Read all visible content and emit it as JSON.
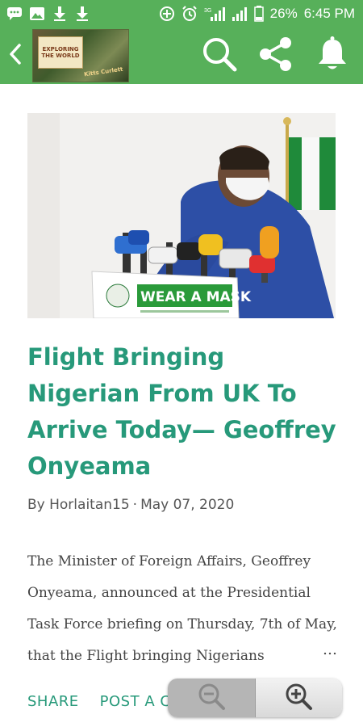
{
  "status_bar": {
    "battery_percent": "26%",
    "time": "6:45 PM",
    "network_label": "3G",
    "left_icons": [
      "chat-icon",
      "image-icon",
      "download-icon",
      "download-icon"
    ],
    "right_icons": [
      "data-saver-icon",
      "alarm-icon",
      "signal-icon",
      "signal-icon",
      "battery-icon"
    ]
  },
  "app_bar": {
    "logo": {
      "line1": "EXPLORING",
      "line2": "THE WORLD",
      "tag": "Kitts Curlett"
    },
    "icons": [
      "back-icon",
      "search-icon",
      "share-icon",
      "bell-icon"
    ]
  },
  "article": {
    "hero_sign": "WEAR A MASK",
    "title": "Flight Bringing Nigerian From UK To Arrive Today— Geoffrey Onyeama",
    "author": "By Horlaitan15",
    "separator": "·",
    "date": "May 07, 2020",
    "excerpt": "The Minister of Foreign Affairs, Geoffrey Onyeama, announced at the Presidential Task Force briefing on Thursday, 7th of May, that the Flight bringing Nigerians",
    "ellipsis": "…",
    "actions": {
      "share": "SHARE",
      "comment": "POST A COMMENT"
    }
  },
  "zoom": {
    "icons": [
      "zoom-out-icon",
      "zoom-in-icon"
    ]
  },
  "colors": {
    "bar_green": "#57b05a",
    "title_teal": "#27997a",
    "link_teal": "#27997a"
  }
}
